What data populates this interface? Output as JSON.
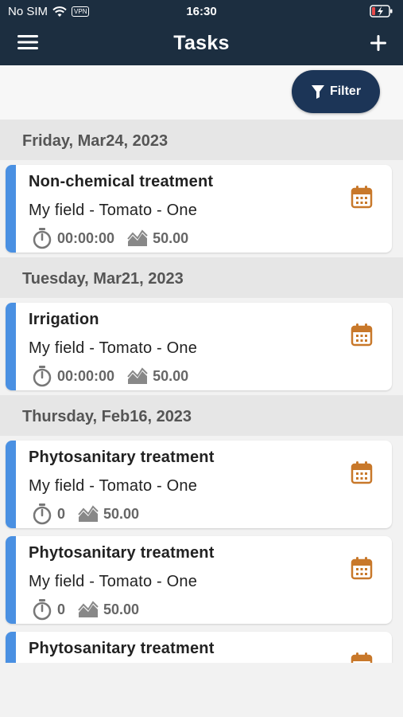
{
  "status_bar": {
    "carrier": "No SIM",
    "vpn": "VPN",
    "time": "16:30"
  },
  "nav": {
    "title": "Tasks"
  },
  "filter": {
    "label": "Filter"
  },
  "groups": [
    {
      "date": "Friday, Mar24, 2023",
      "tasks": [
        {
          "title": "Non-chemical treatment",
          "subtitle": "My field - Tomato - One",
          "duration": "00:00:00",
          "area": "50.00"
        }
      ]
    },
    {
      "date": "Tuesday, Mar21, 2023",
      "tasks": [
        {
          "title": "Irrigation",
          "subtitle": "My field - Tomato - One",
          "duration": "00:00:00",
          "area": "50.00"
        }
      ]
    },
    {
      "date": "Thursday, Feb16, 2023",
      "tasks": [
        {
          "title": "Phytosanitary treatment",
          "subtitle": "My field - Tomato - One",
          "duration": "0",
          "area": "50.00"
        },
        {
          "title": "Phytosanitary treatment",
          "subtitle": "My field - Tomato - One",
          "duration": "0",
          "area": "50.00"
        },
        {
          "title": "Phytosanitary treatment",
          "subtitle": "",
          "duration": "",
          "area": ""
        }
      ]
    }
  ],
  "colors": {
    "header_bg": "#1c2e40",
    "filter_bg": "#1c3557",
    "accent": "#4a90e2",
    "calendar_icon": "#c8782a"
  }
}
